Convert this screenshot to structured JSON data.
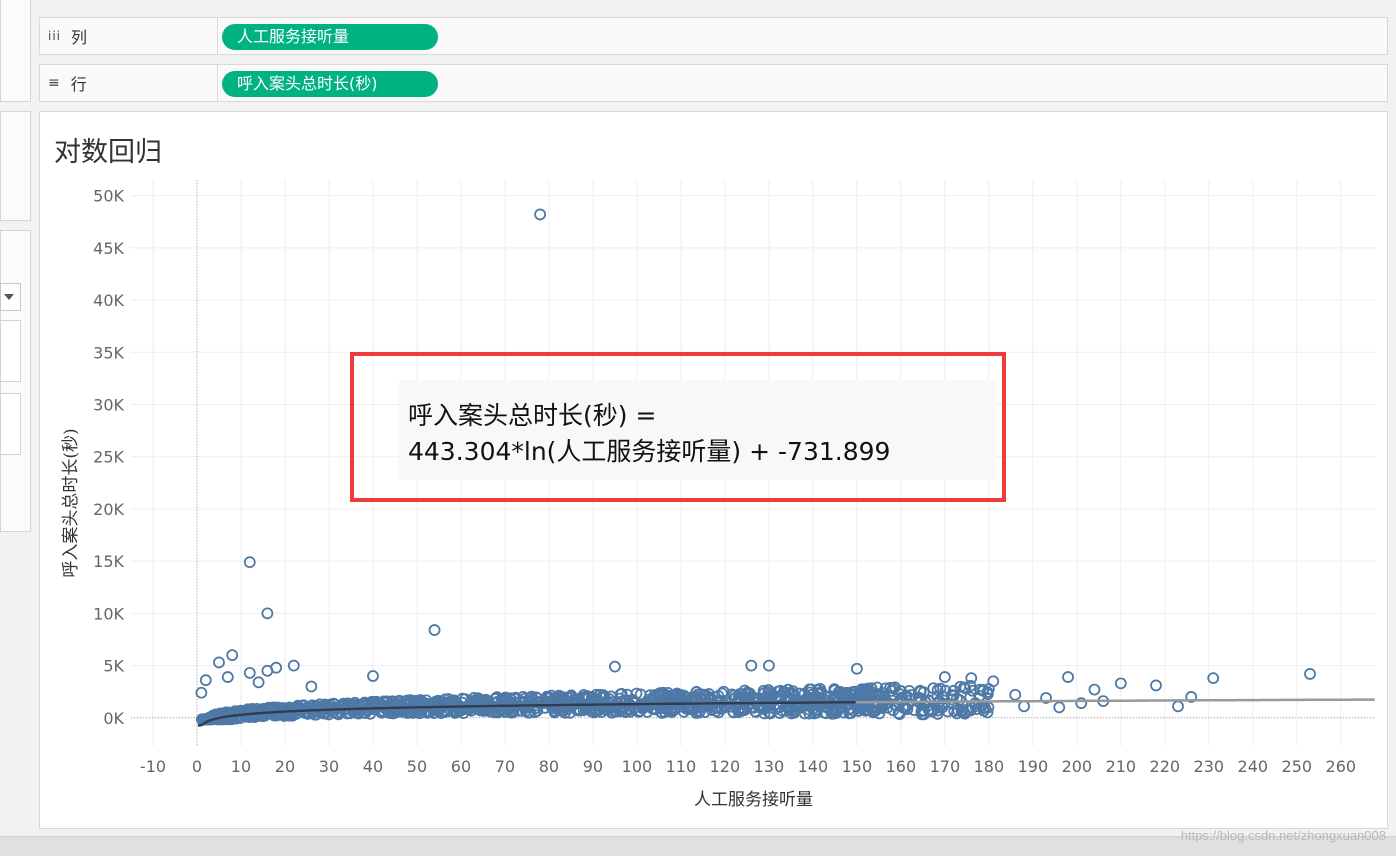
{
  "shelves": {
    "columns": {
      "icon": "iii",
      "label": "列",
      "pill": "人工服务接听量"
    },
    "rows": {
      "icon": "≡",
      "label": "行",
      "pill": "呼入案头总时长(秒)"
    }
  },
  "sheet": {
    "title": "对数回归"
  },
  "annotation": {
    "line1": "呼入案头总时长(秒) =",
    "line2": "443.304*ln(人工服务接听量) + -731.899"
  },
  "watermark": "https://blog.csdn.net/zhongxuan008",
  "colors": {
    "pill": "#00b181",
    "marks": "#4e79a7",
    "highlight_box": "#ef3b3b",
    "trend_line": "#2e3d54"
  },
  "icons": {
    "columns_shelf": "columns-icon",
    "rows_shelf": "rows-icon",
    "dropdown": "chevron-down-icon"
  },
  "chart_data": {
    "type": "scatter",
    "title": "对数回归",
    "xlabel": "人工服务接听量",
    "ylabel": "呼入案头总时长(秒)",
    "xlim": [
      -15,
      268
    ],
    "ylim": [
      -2700,
      51500
    ],
    "xticks": [
      "-10",
      "0",
      "10",
      "20",
      "30",
      "40",
      "50",
      "60",
      "70",
      "80",
      "90",
      "100",
      "110",
      "120",
      "130",
      "140",
      "150",
      "160",
      "170",
      "180",
      "190",
      "200",
      "210",
      "220",
      "230",
      "240",
      "250",
      "260"
    ],
    "xtick_values": [
      -10,
      0,
      10,
      20,
      30,
      40,
      50,
      60,
      70,
      80,
      90,
      100,
      110,
      120,
      130,
      140,
      150,
      160,
      170,
      180,
      190,
      200,
      210,
      220,
      230,
      240,
      250,
      260
    ],
    "yticks": [
      "0K",
      "5K",
      "10K",
      "15K",
      "20K",
      "25K",
      "30K",
      "35K",
      "40K",
      "45K",
      "50K"
    ],
    "ytick_values": [
      0,
      5000,
      10000,
      15000,
      20000,
      25000,
      30000,
      35000,
      40000,
      45000,
      50000
    ],
    "grid": true,
    "trend": {
      "type": "logarithmic",
      "a": 443.304,
      "b": -731.899
    },
    "points": [
      [
        78,
        48200
      ],
      [
        12,
        14900
      ],
      [
        16,
        10000
      ],
      [
        54,
        8400
      ],
      [
        8,
        6000
      ],
      [
        5,
        5300
      ],
      [
        12,
        4300
      ],
      [
        16,
        4500
      ],
      [
        18,
        4800
      ],
      [
        22,
        5000
      ],
      [
        2,
        3600
      ],
      [
        1,
        2400
      ],
      [
        7,
        3900
      ],
      [
        14,
        3400
      ],
      [
        26,
        3000
      ],
      [
        40,
        4000
      ],
      [
        95,
        4900
      ],
      [
        126,
        5000
      ],
      [
        130,
        5000
      ],
      [
        150,
        4700
      ],
      [
        170,
        3900
      ],
      [
        176,
        3800
      ],
      [
        181,
        3500
      ],
      [
        198,
        3900
      ],
      [
        204,
        2700
      ],
      [
        210,
        3300
      ],
      [
        218,
        3100
      ],
      [
        223,
        1100
      ],
      [
        226,
        2000
      ],
      [
        231,
        3800
      ],
      [
        253,
        4200
      ],
      [
        193,
        1900
      ],
      [
        196,
        1000
      ],
      [
        206,
        1600
      ],
      [
        201,
        1400
      ],
      [
        186,
        2200
      ],
      [
        178,
        2700
      ],
      [
        166,
        1100
      ],
      [
        188,
        1100
      ]
    ]
  }
}
